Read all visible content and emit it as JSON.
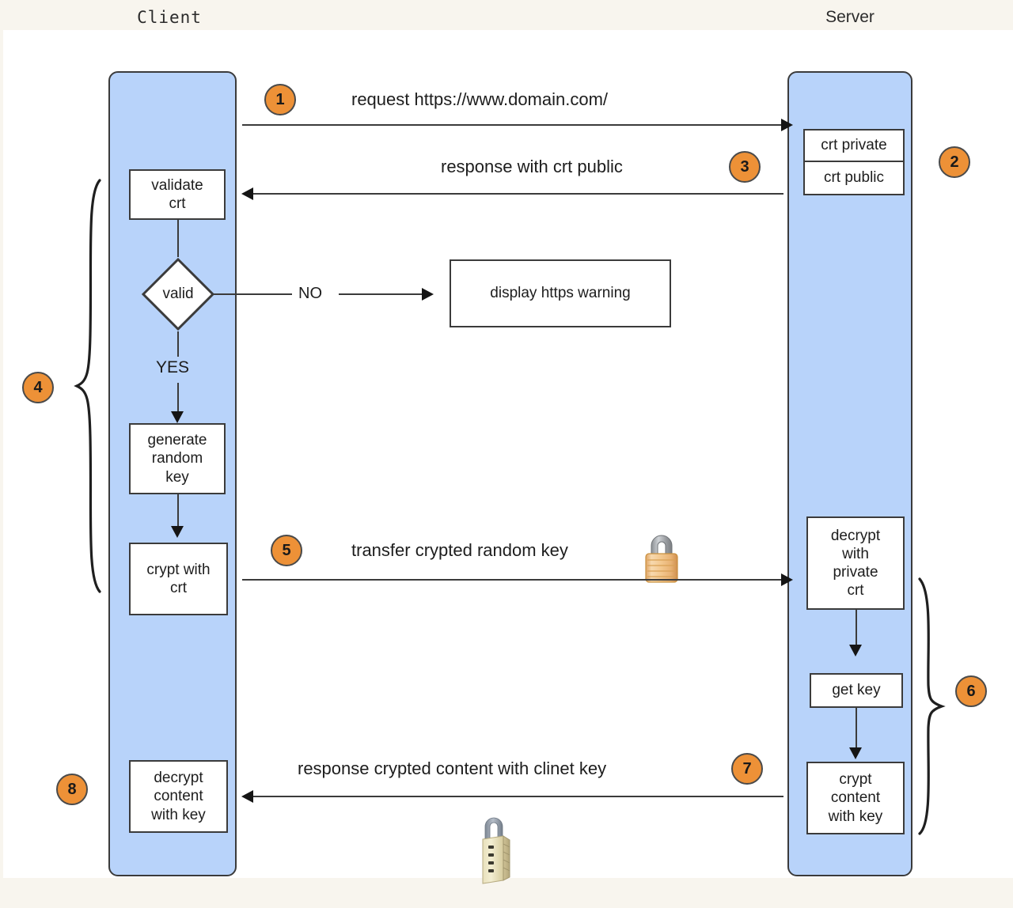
{
  "diagram": {
    "title": "HTTPS/TLS handshake sequence diagram",
    "colors": {
      "lane_fill": "#b8d3fa",
      "badge_fill": "#ed9137",
      "stroke": "#3b3b3b",
      "canvas": "#ffffff",
      "page_background": "#f8f5ee"
    }
  },
  "lanes": [
    {
      "id": "client",
      "label": "Client"
    },
    {
      "id": "server",
      "label": "Server"
    }
  ],
  "client_nodes": {
    "validate_crt": "validate\ncrt",
    "valid_decision": "valid",
    "yes_label": "YES",
    "generate_random_key": "generate\nrandom\nkey",
    "crypt_with_crt": "crypt with\ncrt",
    "decrypt_content_with_key": "decrypt\ncontent\nwith key"
  },
  "server_nodes": {
    "crt_private": "crt private",
    "crt_public": "crt public",
    "decrypt_with_private_crt": "decrypt\nwith\nprivate\ncrt",
    "get_key": "get key",
    "crypt_content_with_key": "crypt\ncontent\nwith key"
  },
  "external_nodes": {
    "display_https_warning": "display https warning",
    "no_label": "NO"
  },
  "messages": {
    "request": "request https://www.domain.com/",
    "response_crt_public": "response with crt public",
    "transfer_key": "transfer crypted random key",
    "response_content": "response crypted content with clinet key"
  },
  "steps": [
    {
      "n": "1",
      "describes": "request https://www.domain.com/"
    },
    {
      "n": "2",
      "describes": "server certificate pair"
    },
    {
      "n": "3",
      "describes": "response with crt public"
    },
    {
      "n": "4",
      "describes": "client validation and key generation"
    },
    {
      "n": "5",
      "describes": "transfer crypted random key"
    },
    {
      "n": "6",
      "describes": "server decrypt and crypt content"
    },
    {
      "n": "7",
      "describes": "response crypted content with clinet key"
    },
    {
      "n": "8",
      "describes": "decrypt content with key"
    }
  ],
  "icons": {
    "closed_padlock": "padlock-closed-icon",
    "combination_padlock": "padlock-combination-icon"
  }
}
